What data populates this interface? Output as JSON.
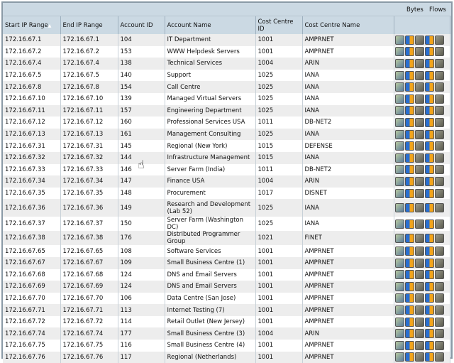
{
  "header": {
    "bytes": "Bytes",
    "flows": "Flows",
    "sort_indicator": "▲"
  },
  "columns": [
    "Start IP Range",
    "End IP Range",
    "Account ID",
    "Account Name",
    "Cost Centre ID",
    "Cost Centre Name"
  ],
  "rows": [
    [
      "172.16.67.1",
      "172.16.67.1",
      "104",
      "IT Department",
      "1001",
      "AMPRNET"
    ],
    [
      "172.16.67.2",
      "172.16.67.2",
      "153",
      "WWW Helpdesk Servers",
      "1001",
      "AMPRNET"
    ],
    [
      "172.16.67.4",
      "172.16.67.4",
      "138",
      "Technical Services",
      "1004",
      "ARIN"
    ],
    [
      "172.16.67.5",
      "172.16.67.5",
      "140",
      "Support",
      "1025",
      "IANA"
    ],
    [
      "172.16.67.8",
      "172.16.67.8",
      "154",
      "Call Centre",
      "1025",
      "IANA"
    ],
    [
      "172.16.67.10",
      "172.16.67.10",
      "139",
      "Managed Virtual Servers",
      "1025",
      "IANA"
    ],
    [
      "172.16.67.11",
      "172.16.67.11",
      "157",
      "Engineering Department",
      "1025",
      "IANA"
    ],
    [
      "172.16.67.12",
      "172.16.67.12",
      "160",
      "Professional Services USA",
      "1011",
      "DB-NET2"
    ],
    [
      "172.16.67.13",
      "172.16.67.13",
      "161",
      "Management Consulting",
      "1025",
      "IANA"
    ],
    [
      "172.16.67.31",
      "172.16.67.31",
      "145",
      "Regional (New York)",
      "1015",
      "DEFENSE"
    ],
    [
      "172.16.67.32",
      "172.16.67.32",
      "144",
      "Infrastructure Management",
      "1015",
      "IANA"
    ],
    [
      "172.16.67.33",
      "172.16.67.33",
      "146",
      "Server Farm (India)",
      "1011",
      "DB-NET2"
    ],
    [
      "172.16.67.34",
      "172.16.67.34",
      "147",
      "Finance USA",
      "1004",
      "ARIN"
    ],
    [
      "172.16.67.35",
      "172.16.67.35",
      "148",
      "Procurement",
      "1017",
      "DISNET"
    ],
    [
      "172.16.67.36",
      "172.16.67.36",
      "149",
      "Research and Development (Lab 52)",
      "1025",
      "IANA"
    ],
    [
      "172.16.67.37",
      "172.16.67.37",
      "150",
      "Server Farm (Washington DC)",
      "1025",
      "IANA"
    ],
    [
      "172.16.67.38",
      "172.16.67.38",
      "176",
      "Distributed Programmer Group",
      "1021",
      "FINET"
    ],
    [
      "172.16.67.65",
      "172.16.67.65",
      "108",
      "Software Services",
      "1001",
      "AMPRNET"
    ],
    [
      "172.16.67.67",
      "172.16.67.67",
      "109",
      "Small Business Centre (1)",
      "1001",
      "AMPRNET"
    ],
    [
      "172.16.67.68",
      "172.16.67.68",
      "124",
      "DNS and Email Servers",
      "1001",
      "AMPRNET"
    ],
    [
      "172.16.67.69",
      "172.16.67.69",
      "124",
      "DNS and Email Servers",
      "1001",
      "AMPRNET"
    ],
    [
      "172.16.67.70",
      "172.16.67.70",
      "106",
      "Data Centre (San Jose)",
      "1001",
      "AMPRNET"
    ],
    [
      "172.16.67.71",
      "172.16.67.71",
      "113",
      "Internet Testing (7)",
      "1001",
      "AMPRNET"
    ],
    [
      "172.16.67.72",
      "172.16.67.72",
      "114",
      "Retail Outlet (New Jersey)",
      "1001",
      "AMPRNET"
    ],
    [
      "172.16.67.74",
      "172.16.67.74",
      "177",
      "Small Business Centre (3)",
      "1004",
      "ARIN"
    ],
    [
      "172.16.67.75",
      "172.16.67.75",
      "116",
      "Small Business Centre (4)",
      "1001",
      "AMPRNET"
    ],
    [
      "172.16.67.76",
      "172.16.67.76",
      "117",
      "Regional (Netherlands)",
      "1001",
      "AMPRNET"
    ]
  ],
  "row_icons": [
    "details-icon",
    "bytes-chart-icon",
    "bytes-report-icon",
    "flows-chart-icon",
    "flows-report-icon"
  ]
}
